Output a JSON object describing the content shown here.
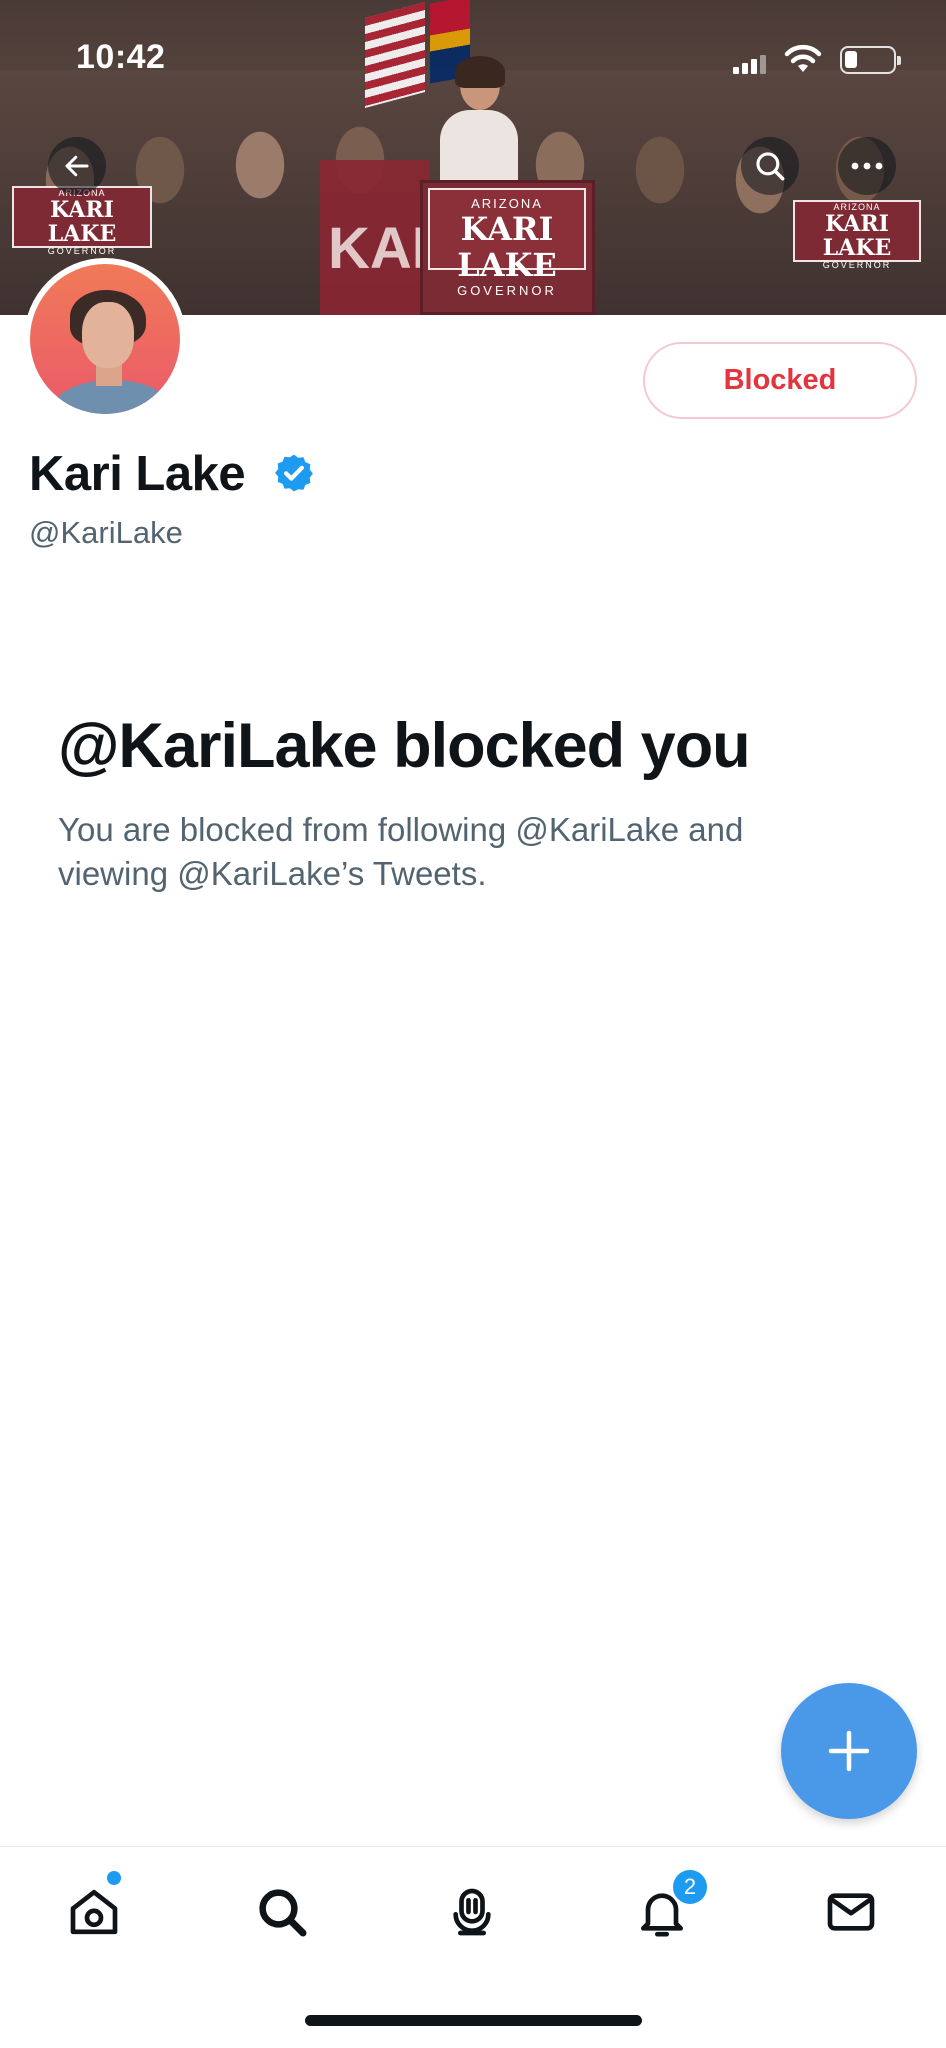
{
  "status_bar": {
    "time": "10:42"
  },
  "banner": {
    "podium_sign": {
      "line1": "ARIZONA",
      "line2": "KARI LAKE",
      "line3": "GOVERNOR"
    },
    "side_sign": {
      "line1": "ARIZONA",
      "line2": "KARI LAKE",
      "line3": "GOVERNOR"
    },
    "banner_text": "KAR"
  },
  "profile": {
    "name": "Kari Lake",
    "handle": "@KariLake",
    "blocked_button_label": "Blocked"
  },
  "blocked_notice": {
    "title": "@KariLake blocked you",
    "description": "You are blocked from following @KariLake and viewing @KariLake’s Tweets."
  },
  "tab_bar": {
    "notifications_badge": "2"
  },
  "icons": {
    "back": "arrow-left-icon",
    "search": "search-icon",
    "more": "more-horizontal-icon",
    "verified": "verified-badge-icon",
    "compose": "plus-icon",
    "home": "home-icon",
    "explore": "search-icon",
    "spaces": "spaces-mic-icon",
    "notifications": "bell-icon",
    "messages": "mail-icon"
  },
  "colors": {
    "accent": "#1d9bf0",
    "blocked_red": "#e2353e",
    "fab_blue": "#4a99e9"
  }
}
